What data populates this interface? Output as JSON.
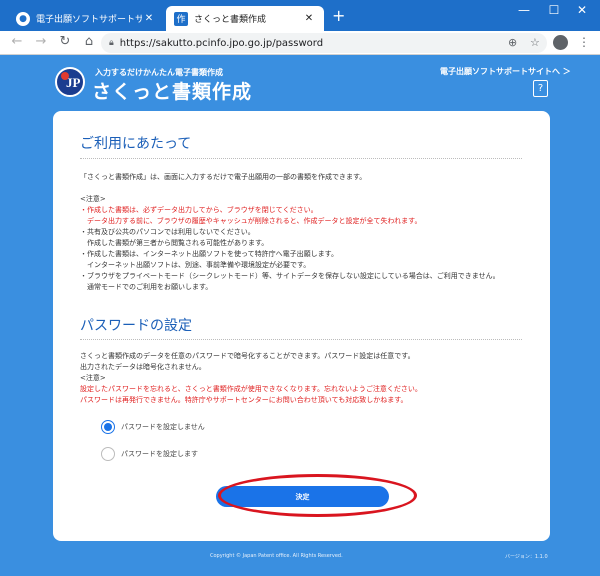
{
  "browser": {
    "tabs": [
      {
        "title": "電子出願ソフトサポートサイト  さく",
        "favicon": "person-favicon"
      },
      {
        "title": "さくっと書類作成",
        "favicon": "作"
      }
    ],
    "url": "https://sakutto.pcinfo.jpo.go.jp/password"
  },
  "header": {
    "logo_text": "JP",
    "logo_subtitle": "入力するだけかんたん電子書類作成",
    "logo_title": "さくっと書類作成",
    "support_link": "電子出願ソフトサポートサイトへ ＞",
    "help_icon": "?"
  },
  "usage": {
    "title": "ご利用にあたって",
    "intro": "「さくっと書類作成」は、画面に入力するだけで電子出願用の一部の書類を作成できます。",
    "notes_label": "<注意>",
    "notes": [
      {
        "text": "・作成した書類は、必ずデータ出力してから、ブラウザを閉じてください。",
        "red": true
      },
      {
        "text": "　データ出力する前に、ブラウザの履歴やキャッシュが削除されると、作成データと設定が全て失われます。",
        "red": true
      },
      {
        "text": "・共有及び公共のパソコンでは利用しないでください。",
        "red": false
      },
      {
        "text": "　作成した書類が第三者から閲覧される可能性があります。",
        "red": false
      },
      {
        "text": "・作成した書類は、インターネット出願ソフトを使って特許庁へ電子出願します。",
        "red": false
      },
      {
        "text": "　インターネット出願ソフトは、別途、事前準備や環境設定が必要です。",
        "red": false
      },
      {
        "text": "・ブラウザをプライベートモード（シークレットモード）等、サイトデータを保存しない設定にしている場合は、ご利用できません。",
        "red": false
      },
      {
        "text": "　通常モードでのご利用をお願いします。",
        "red": false
      }
    ]
  },
  "password": {
    "title": "パスワードの設定",
    "description": [
      "さくっと書類作成のデータを任意のパスワードで暗号化することができます。パスワード設定は任意です。",
      "出力されたデータは暗号化されません。"
    ],
    "notes_label": "<注意>",
    "warnings": [
      "設定したパスワードを忘れると、さくっと書類作成が使用できなくなります。忘れないようご注意ください。",
      "パスワードは再発行できません。特許庁やサポートセンターにお問い合わせ頂いても対応致しかねます。"
    ],
    "options": [
      {
        "label": "パスワードを設定しません",
        "selected": true
      },
      {
        "label": "パスワードを設定します",
        "selected": false
      }
    ],
    "submit": "決定"
  },
  "footer": {
    "copyright": "Copyright © Japan Patent office. All Rights Reserved.",
    "version": "バージョン：1.1.0"
  },
  "colors": {
    "background": "#3a8fe0",
    "accent": "#1a73e8",
    "title": "#1b5fb8",
    "warning": "#e02020",
    "highlight": "#d9151f"
  }
}
